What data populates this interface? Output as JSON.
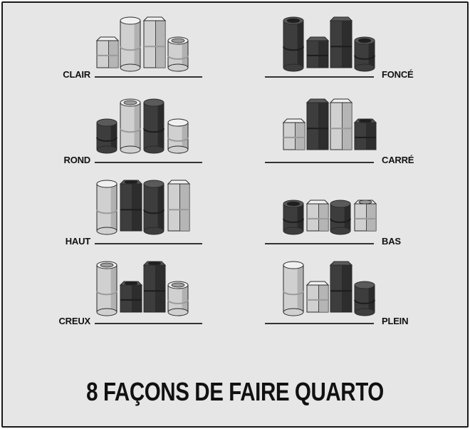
{
  "title": "8 FAÇONS DE FAIRE QUARTO",
  "colors": {
    "light": "#d0d0d0",
    "dark": "#3d3d3d",
    "background": "#e6e6e6",
    "ink": "#111111"
  },
  "panels": [
    {
      "label": "CLAIR",
      "pieces": [
        {
          "shape": "square",
          "color": "light",
          "height": "short",
          "top": "solid"
        },
        {
          "shape": "round",
          "color": "light",
          "height": "tall",
          "top": "solid"
        },
        {
          "shape": "square",
          "color": "light",
          "height": "tall",
          "top": "solid"
        },
        {
          "shape": "round",
          "color": "light",
          "height": "short",
          "top": "hollow"
        }
      ]
    },
    {
      "label": "FONCÉ",
      "pieces": [
        {
          "shape": "round",
          "color": "dark",
          "height": "tall",
          "top": "hollow"
        },
        {
          "shape": "square",
          "color": "dark",
          "height": "short",
          "top": "solid"
        },
        {
          "shape": "square",
          "color": "dark",
          "height": "tall",
          "top": "solid"
        },
        {
          "shape": "round",
          "color": "dark",
          "height": "short",
          "top": "hollow"
        }
      ]
    },
    {
      "label": "ROND",
      "pieces": [
        {
          "shape": "round",
          "color": "dark",
          "height": "short",
          "top": "solid"
        },
        {
          "shape": "round",
          "color": "light",
          "height": "tall",
          "top": "hollow"
        },
        {
          "shape": "round",
          "color": "dark",
          "height": "tall",
          "top": "solid"
        },
        {
          "shape": "round",
          "color": "light",
          "height": "short",
          "top": "solid"
        }
      ]
    },
    {
      "label": "CARRÉ",
      "pieces": [
        {
          "shape": "square",
          "color": "light",
          "height": "short",
          "top": "solid"
        },
        {
          "shape": "square",
          "color": "dark",
          "height": "tall",
          "top": "solid"
        },
        {
          "shape": "square",
          "color": "light",
          "height": "tall",
          "top": "solid"
        },
        {
          "shape": "square",
          "color": "dark",
          "height": "short",
          "top": "hollow"
        }
      ]
    },
    {
      "label": "HAUT",
      "pieces": [
        {
          "shape": "round",
          "color": "light",
          "height": "tall",
          "top": "solid"
        },
        {
          "shape": "square",
          "color": "dark",
          "height": "tall",
          "top": "hollow"
        },
        {
          "shape": "round",
          "color": "dark",
          "height": "tall",
          "top": "solid"
        },
        {
          "shape": "square",
          "color": "light",
          "height": "tall",
          "top": "solid"
        }
      ]
    },
    {
      "label": "BAS",
      "pieces": [
        {
          "shape": "round",
          "color": "dark",
          "height": "short",
          "top": "hollow"
        },
        {
          "shape": "square",
          "color": "light",
          "height": "short",
          "top": "solid"
        },
        {
          "shape": "round",
          "color": "dark",
          "height": "short",
          "top": "solid"
        },
        {
          "shape": "square",
          "color": "light",
          "height": "short",
          "top": "hollow"
        }
      ]
    },
    {
      "label": "CREUX",
      "pieces": [
        {
          "shape": "round",
          "color": "light",
          "height": "tall",
          "top": "hollow"
        },
        {
          "shape": "square",
          "color": "dark",
          "height": "short",
          "top": "hollow"
        },
        {
          "shape": "square",
          "color": "dark",
          "height": "tall",
          "top": "hollow"
        },
        {
          "shape": "round",
          "color": "light",
          "height": "short",
          "top": "hollow"
        }
      ]
    },
    {
      "label": "PLEIN",
      "pieces": [
        {
          "shape": "round",
          "color": "light",
          "height": "tall",
          "top": "solid"
        },
        {
          "shape": "square",
          "color": "light",
          "height": "short",
          "top": "solid"
        },
        {
          "shape": "square",
          "color": "dark",
          "height": "tall",
          "top": "solid"
        },
        {
          "shape": "round",
          "color": "dark",
          "height": "short",
          "top": "solid"
        }
      ]
    }
  ]
}
